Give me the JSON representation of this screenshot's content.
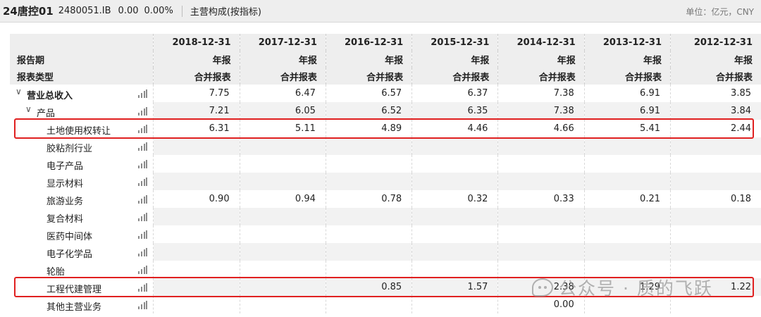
{
  "header": {
    "name": "24唐控01",
    "code": "2480051.IB",
    "change": "0.00",
    "change_pct": "0.00%",
    "section": "主营构成(按指标)",
    "unit": "单位：亿元，CNY"
  },
  "table": {
    "label_period": "报告期",
    "label_type": "报表类型",
    "columns": [
      {
        "date": "2018-12-31",
        "period": "年报",
        "type": "合并报表"
      },
      {
        "date": "2017-12-31",
        "period": "年报",
        "type": "合并报表"
      },
      {
        "date": "2016-12-31",
        "period": "年报",
        "type": "合并报表"
      },
      {
        "date": "2015-12-31",
        "period": "年报",
        "type": "合并报表"
      },
      {
        "date": "2014-12-31",
        "period": "年报",
        "type": "合并报表"
      },
      {
        "date": "2013-12-31",
        "period": "年报",
        "type": "合并报表"
      },
      {
        "date": "2012-12-31",
        "period": "年报",
        "type": "合并报表"
      }
    ],
    "rows": [
      {
        "label": "营业总收入",
        "level": 0,
        "expand": "∨",
        "bold": true,
        "values": [
          "7.75",
          "6.47",
          "6.57",
          "6.37",
          "7.38",
          "6.91",
          "3.85"
        ]
      },
      {
        "label": "产品",
        "level": 1,
        "expand": "∨",
        "values": [
          "7.21",
          "6.05",
          "6.52",
          "6.35",
          "7.38",
          "6.91",
          "3.84"
        ]
      },
      {
        "label": "土地使用权转让",
        "level": 2,
        "highlighted": true,
        "values": [
          "6.31",
          "5.11",
          "4.89",
          "4.46",
          "4.66",
          "5.41",
          "2.44"
        ]
      },
      {
        "label": "胶粘剂行业",
        "level": 2,
        "values": [
          "",
          "",
          "",
          "",
          "",
          "",
          ""
        ]
      },
      {
        "label": "电子产品",
        "level": 2,
        "values": [
          "",
          "",
          "",
          "",
          "",
          "",
          ""
        ]
      },
      {
        "label": "显示材料",
        "level": 2,
        "values": [
          "",
          "",
          "",
          "",
          "",
          "",
          ""
        ]
      },
      {
        "label": "旅游业务",
        "level": 2,
        "values": [
          "0.90",
          "0.94",
          "0.78",
          "0.32",
          "0.33",
          "0.21",
          "0.18"
        ]
      },
      {
        "label": "复合材料",
        "level": 2,
        "values": [
          "",
          "",
          "",
          "",
          "",
          "",
          ""
        ]
      },
      {
        "label": "医药中间体",
        "level": 2,
        "values": [
          "",
          "",
          "",
          "",
          "",
          "",
          ""
        ]
      },
      {
        "label": "电子化学品",
        "level": 2,
        "values": [
          "",
          "",
          "",
          "",
          "",
          "",
          ""
        ]
      },
      {
        "label": "轮胎",
        "level": 2,
        "values": [
          "",
          "",
          "",
          "",
          "",
          "",
          ""
        ]
      },
      {
        "label": "工程代建管理",
        "level": 2,
        "highlighted": true,
        "values": [
          "",
          "",
          "0.85",
          "1.57",
          "2.38",
          "1.29",
          "1.22"
        ]
      },
      {
        "label": "其他主营业务",
        "level": 2,
        "values": [
          "",
          "",
          "",
          "",
          "0.00",
          "",
          ""
        ]
      }
    ]
  },
  "watermark": {
    "text": "公众号 · 质的飞跃",
    "icon": "wechat-icon"
  },
  "colors": {
    "highlight": "#e02020",
    "header_bg": "#eeeeee",
    "alt_row": "#f2f2f2"
  }
}
